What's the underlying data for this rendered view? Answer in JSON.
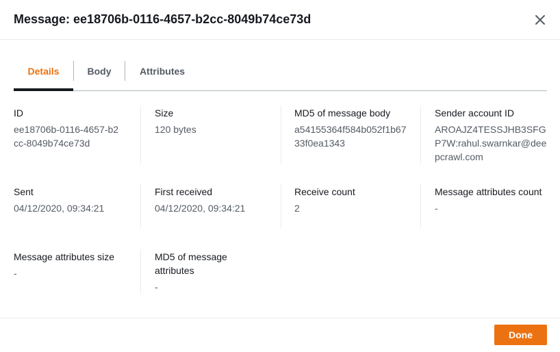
{
  "dialog": {
    "title": "Message: ee18706b-0116-4657-b2cc-8049b74ce73d",
    "close_icon": "close-icon"
  },
  "tabs": [
    {
      "label": "Details",
      "active": true
    },
    {
      "label": "Body",
      "active": false
    },
    {
      "label": "Attributes",
      "active": false
    }
  ],
  "details": {
    "id": {
      "label": "ID",
      "value": "ee18706b-0116-4657-b2cc-8049b74ce73d"
    },
    "size": {
      "label": "Size",
      "value": "120 bytes"
    },
    "md5_body": {
      "label": "MD5 of message body",
      "value": "a54155364f584b052f1b6733f0ea1343"
    },
    "sender": {
      "label": "Sender account ID",
      "value": "AROAJZ4TESSJHB3SFGP7W:rahul.swarnkar@deepcrawl.com"
    },
    "sent": {
      "label": "Sent",
      "value": "04/12/2020, 09:34:21"
    },
    "first_received": {
      "label": "First received",
      "value": "04/12/2020, 09:34:21"
    },
    "receive_count": {
      "label": "Receive count",
      "value": "2"
    },
    "attr_count": {
      "label": "Message attributes count",
      "value": "-"
    },
    "attr_size": {
      "label": "Message attributes size",
      "value": "-"
    },
    "md5_attr": {
      "label": "MD5 of message attributes",
      "value": "-"
    }
  },
  "footer": {
    "done_label": "Done"
  },
  "colors": {
    "accent": "#ec7211",
    "text": "#16191f",
    "muted": "#545b64"
  }
}
